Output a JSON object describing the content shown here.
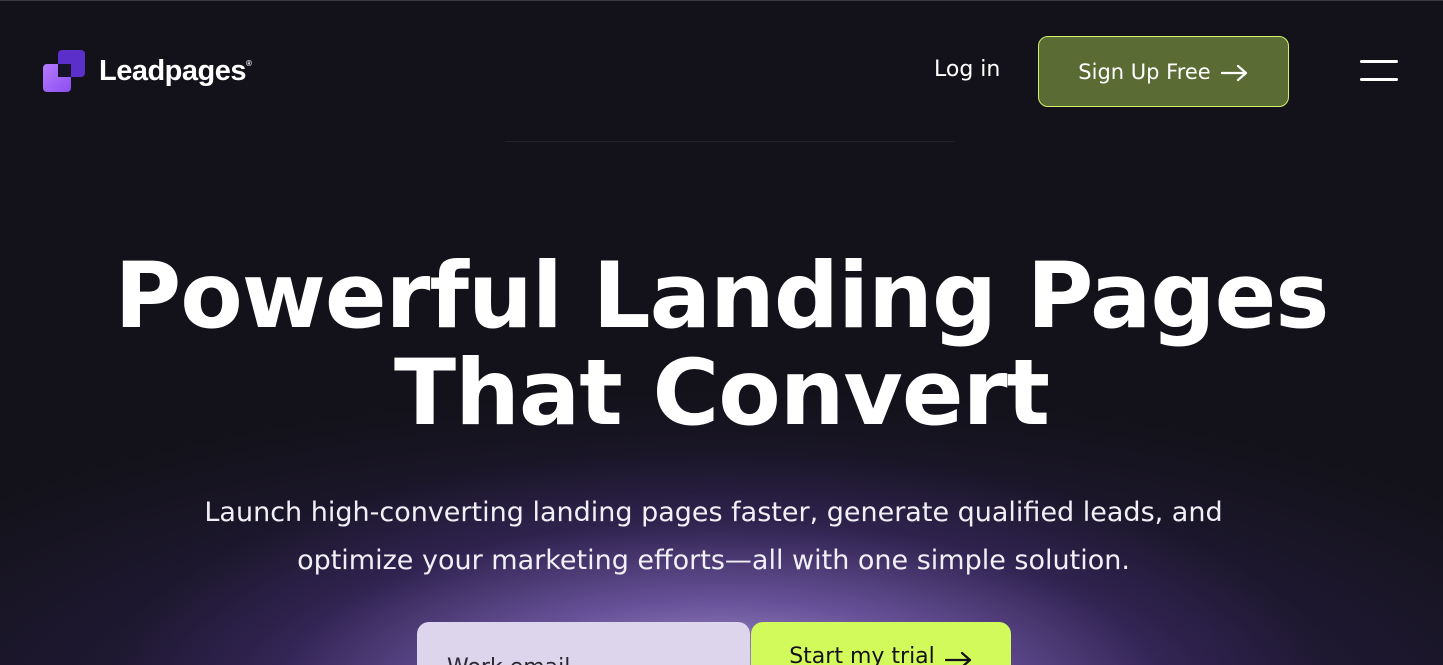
{
  "brand": {
    "name": "Leadpages",
    "trademark": "®",
    "logo_icon": "leadpages-logo-icon"
  },
  "nav": {
    "login_label": "Log in",
    "signup_label": "Sign Up Free",
    "signup_icon": "arrow-right-icon",
    "menu_icon": "hamburger-menu-icon"
  },
  "hero": {
    "title_line1": "Powerful Landing Pages",
    "title_line2": "That Convert",
    "subtitle_line1": "Launch high-converting landing pages faster, generate qualified leads, and",
    "subtitle_line2": "optimize your marketing efforts—all with one simple solution."
  },
  "form": {
    "email_placeholder": "Work email",
    "email_value": "",
    "submit_label": "Start my trial",
    "submit_icon": "arrow-right-icon"
  },
  "colors": {
    "background": "#13121a",
    "signup_button": "#5a6b34",
    "signup_border": "#d4f26a",
    "trial_button": "#d2fa5a",
    "input_background": "#dcd5ec",
    "logo_purple": "#8b4ef0"
  }
}
